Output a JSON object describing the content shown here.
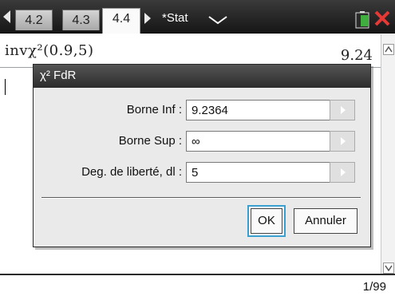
{
  "topbar": {
    "tabs": [
      {
        "label": "4.2"
      },
      {
        "label": "4.3"
      },
      {
        "label": "4.4",
        "active": true
      }
    ],
    "document_title": "*Stat"
  },
  "calculator": {
    "history_expression": "invχ²(0.9,5)",
    "history_result": "9.24"
  },
  "dialog": {
    "title": "χ² FdR",
    "fields": [
      {
        "label": "Borne Inf :",
        "value": "9.2364"
      },
      {
        "label": "Borne Sup :",
        "value": "∞"
      },
      {
        "label": "Deg. de liberté, dl :",
        "value": "5"
      }
    ],
    "ok_label": "OK",
    "cancel_label": "Annuler"
  },
  "status": {
    "page_indicator": "1/99"
  },
  "colors": {
    "close_red": "#e53935",
    "battery_green": "#3fae3f",
    "focus_blue": "#3aa0d0"
  }
}
